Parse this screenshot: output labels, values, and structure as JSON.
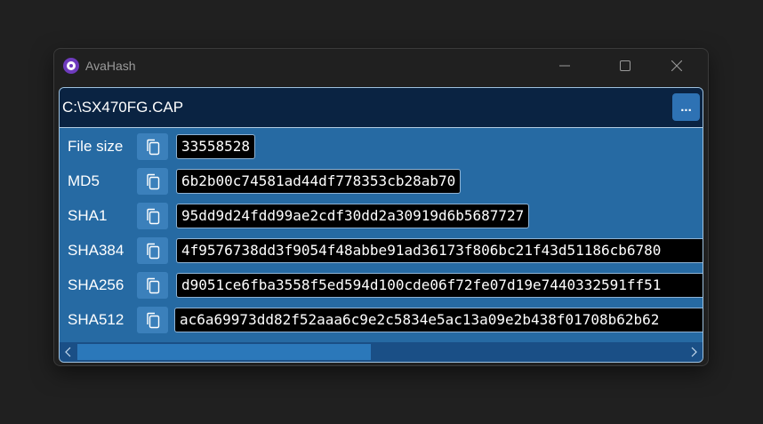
{
  "window": {
    "title": "AvaHash",
    "icons": {
      "app": "avahash-logo-icon",
      "minimize": "minimize-icon",
      "maximize": "maximize-icon",
      "close": "close-icon"
    }
  },
  "path": {
    "value": "C:\\SX470FG.CAP",
    "browse_label": "..."
  },
  "rows": [
    {
      "label": "File size",
      "value": "33558528"
    },
    {
      "label": "MD5",
      "value": "6b2b00c74581ad44df778353cb28ab70"
    },
    {
      "label": "SHA1",
      "value": "95dd9d24fdd99ae2cdf30dd2a30919d6b5687727"
    },
    {
      "label": "SHA384",
      "value": "4f9576738dd3f9054f48abbe91ad36173f806bc21f43d51186cb6780"
    },
    {
      "label": "SHA256",
      "value": "d9051ce6fba3558f5ed594d100cde06f72fe07d19e7440332591ff51"
    },
    {
      "label": "SHA512",
      "value": "ac6a69973dd82f52aaa6c9e2c5834e5ac13a09e2b438f01708b62b62"
    }
  ],
  "colors": {
    "accent": "#2e72b4",
    "path_bar": "#0a2342",
    "rows_bg": "#266aa3",
    "hash_bg": "#000000"
  },
  "copy_icon": "copy-icon"
}
